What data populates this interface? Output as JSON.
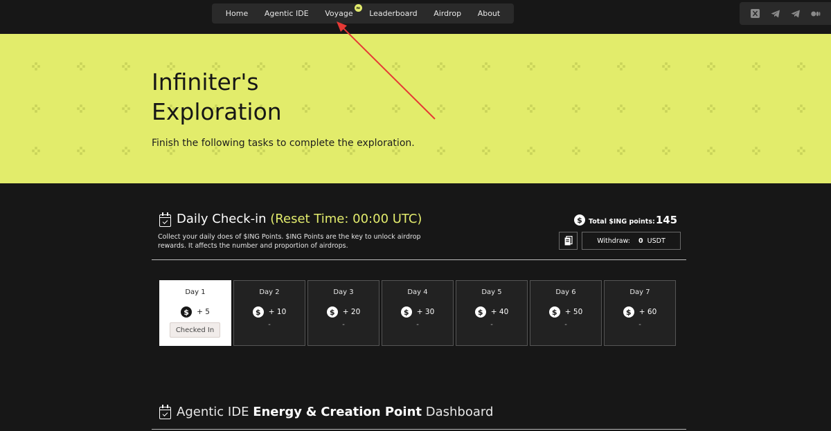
{
  "nav": {
    "items": [
      {
        "label": "Home"
      },
      {
        "label": "Agentic IDE"
      },
      {
        "label": "Voyage",
        "badge": "≈"
      },
      {
        "label": "Leaderboard"
      },
      {
        "label": "Airdrop"
      },
      {
        "label": "About"
      }
    ]
  },
  "social": [
    "x-icon",
    "telegram-icon",
    "telegram-icon",
    "medium-icon"
  ],
  "hero": {
    "title_line1": "Infiniter's",
    "title_line2": "Exploration",
    "subtitle": "Finish the following tasks to complete the exploration.",
    "background": "#e2ec6b"
  },
  "checkin": {
    "title": "Daily Check-in",
    "reset": "(Reset Time: 00:00 UTC)",
    "description": "Collect your daily does of $ING Points. $ING Points are the key to unlock airdrop rewards. It affects the number and proportion of airdrops.",
    "points_label": "Total $ING points:",
    "points_value": "145",
    "withdraw_label": "Withdraw:",
    "withdraw_amount": "0",
    "withdraw_unit": "USDT"
  },
  "days": [
    {
      "label": "Day 1",
      "reward": "+ 5",
      "status": "Checked In",
      "checked": true
    },
    {
      "label": "Day 2",
      "reward": "+ 10",
      "status": "-"
    },
    {
      "label": "Day 3",
      "reward": "+ 20",
      "status": "-"
    },
    {
      "label": "Day 4",
      "reward": "+ 30",
      "status": "-"
    },
    {
      "label": "Day 5",
      "reward": "+ 40",
      "status": "-"
    },
    {
      "label": "Day 6",
      "reward": "+ 50",
      "status": "-"
    },
    {
      "label": "Day 7",
      "reward": "+ 60",
      "status": "-"
    }
  ],
  "dashboard": {
    "part1": "Agentic IDE",
    "part2": "Energy",
    "part3": "&",
    "part4": "Creation Point",
    "part5": "Dashboard"
  },
  "colors": {
    "accent": "#e3ec6d",
    "background": "#171717",
    "arrow": "#e53935"
  }
}
